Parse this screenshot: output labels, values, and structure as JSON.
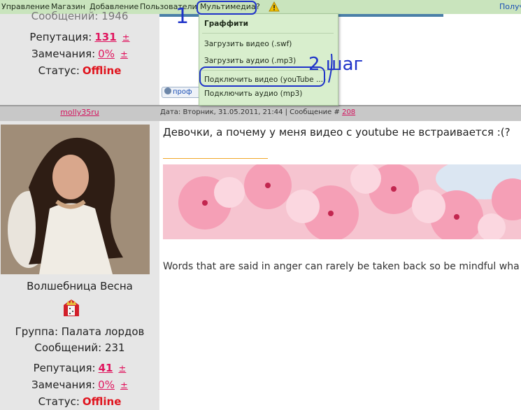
{
  "menu": {
    "items": [
      "Управление",
      "Магазин",
      "Добавление",
      "Пользователи",
      "Мультимедиа",
      "?"
    ],
    "right_label": "Получ"
  },
  "dropdown": {
    "header": "Граффити",
    "items": [
      "Загрузить видео (.swf)",
      "Загрузить аудио (.mp3)",
      "Подключить видео (youTube ...)",
      "Подключить аудио (mp3)"
    ]
  },
  "post1_user": {
    "messages_label": "Сообщений: 1946",
    "reputation_label": "Репутация:",
    "reputation_value": "131",
    "pm": "±",
    "warnings_label": "Замечания:",
    "warnings_value": "0%",
    "status_label": "Статус:",
    "status_value": "Offline"
  },
  "post1": {
    "profile_button": "проф"
  },
  "post2": {
    "author": "molly35ru",
    "meta_prefix": "Дата: Вторник, 31.05.2011, 21:44 | Сообщение #",
    "message_number": "208",
    "title": "Девочки, а почему у меня видео с youtube не встраивается :(?",
    "quote": "Words that are said in anger can rarely be taken back so be mindful wha"
  },
  "post2_user": {
    "name": "Волшебница Весна",
    "group": "Группа: Палата лордов",
    "messages": "Сообщений: 231",
    "reputation_label": "Репутация:",
    "reputation_value": "41",
    "pm": "±",
    "warnings_label": "Замечания:",
    "warnings_value": "0%",
    "status_label": "Статус:",
    "status_value": "Offline"
  },
  "annotations": {
    "step1": "1",
    "step2": "2 шаг"
  },
  "colors": {
    "menubar": "#c9e4bd",
    "dropdown": "#d8eecd",
    "accent": "#e0155e",
    "annotation": "#1f33c9"
  }
}
